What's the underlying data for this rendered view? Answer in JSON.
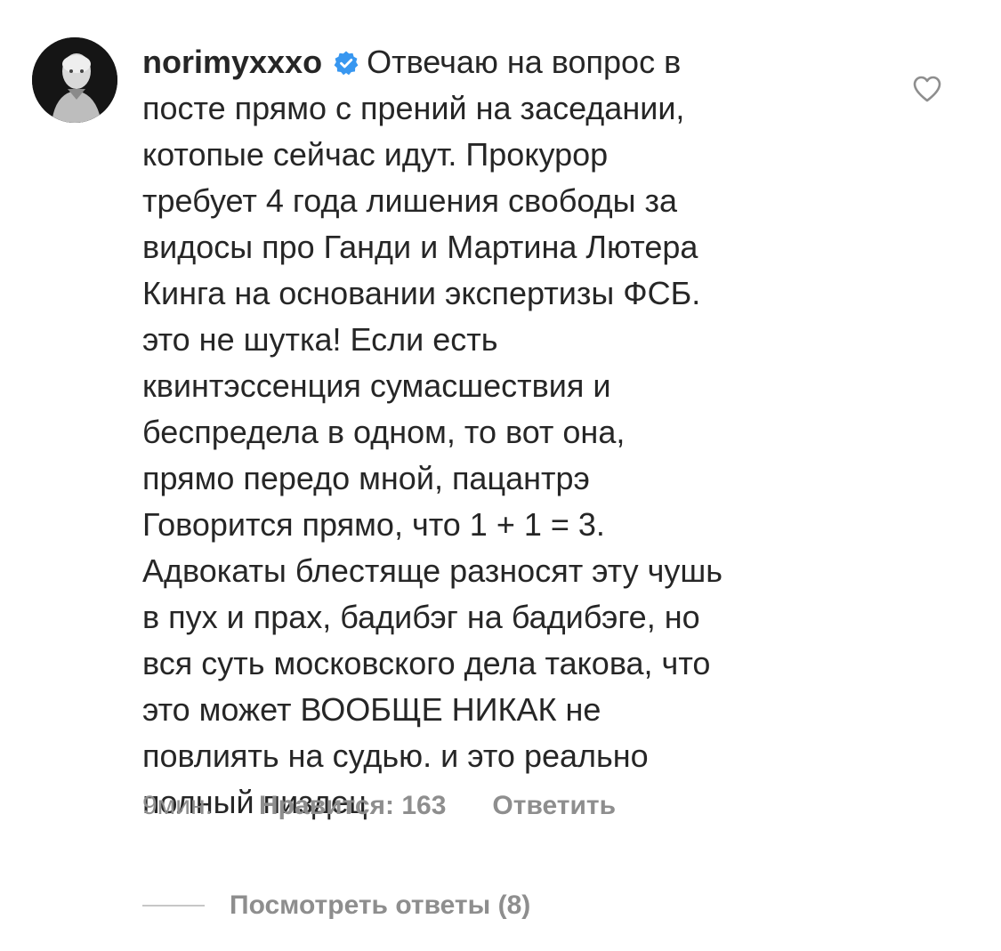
{
  "comment": {
    "username": "norimyxxxo",
    "verified_icon": "verified-badge-icon",
    "text_lines": [
      "Отвечаю на вопрос в",
      "посте прямо с прений на заседании,",
      "котопые сейчас идут. Прокурор",
      "требует 4 года лишения свободы за",
      "видосы про Ганди и Мартина Лютера",
      "Кинга на основании экспертизы ФСБ.",
      "это не шутка! Если есть",
      "квинтэссенция сумасшествия и",
      "беспредела в одном, то вот она,",
      "прямо передо мной, пацантрэ",
      "Говорится прямо, что 1 + 1 = 3.",
      "Адвокаты блестяще разносят эту чушь",
      "в пух и прах, бадибэг на бадибэге, но",
      "вся суть московского дела такова, что",
      "это может ВООБЩЕ НИКАК не",
      "повлиять на судью. и это реально",
      "полный пиздец"
    ],
    "time": "9мин.",
    "likes": "Нравится: 163",
    "reply_label": "Ответить",
    "view_replies": "Посмотреть ответы (8)",
    "like_icon": "heart-outline-icon",
    "avatar_icon": "avatar"
  },
  "colors": {
    "text": "#262626",
    "secondary": "#8e8e8e",
    "verified_blue": "#3897f0",
    "rule": "#c7c7c7"
  }
}
